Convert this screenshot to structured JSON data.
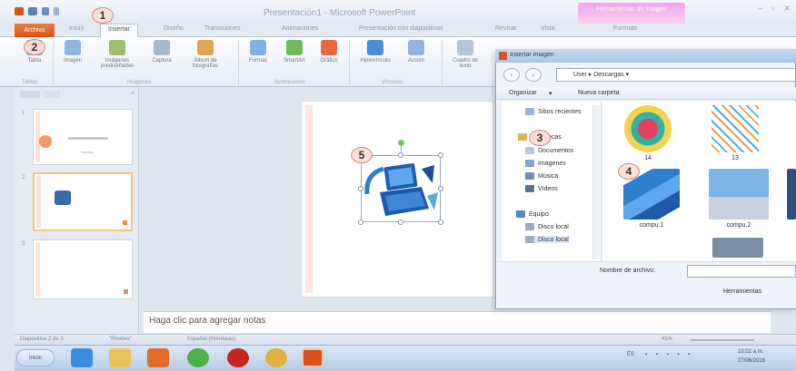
{
  "window": {
    "title": "Presentación1 - Microsoft PowerPoint",
    "context_tab_group": "Herramientas de imagen",
    "controls": [
      "–",
      "▫",
      "✕"
    ]
  },
  "tabs": {
    "file": "Archivo",
    "items": [
      {
        "label": "Inicio"
      },
      {
        "label": "Insertar",
        "active": true
      },
      {
        "label": "Diseño"
      },
      {
        "label": "Transiciones"
      },
      {
        "label": "Animaciones"
      },
      {
        "label": "Presentación con diapositivas"
      },
      {
        "label": "Revisar"
      },
      {
        "label": "Vista"
      },
      {
        "label": "Formato"
      }
    ]
  },
  "ribbon": {
    "buttons": [
      {
        "label": "Tabla",
        "icon": "table-icon",
        "color": "#7aa3d8"
      },
      {
        "label": "Imagen",
        "icon": "picture-icon",
        "color": "#8fb6e0"
      },
      {
        "label": "Imágenes prediseñadas",
        "icon": "clipart-icon",
        "color": "#9bc26b"
      },
      {
        "label": "Captura",
        "icon": "screenshot-icon",
        "color": "#a7b9cf"
      },
      {
        "label": "Álbum de fotografías",
        "icon": "photo-album-icon",
        "color": "#e2a455"
      },
      {
        "label": "Formas",
        "icon": "shapes-icon",
        "color": "#7cb2e8"
      },
      {
        "label": "SmartArt",
        "icon": "smartart-icon",
        "color": "#6dbb5a"
      },
      {
        "label": "Gráfico",
        "icon": "chart-icon",
        "color": "#e46a3a"
      },
      {
        "label": "Hipervínculo",
        "icon": "hyperlink-icon",
        "color": "#4a8fd6"
      },
      {
        "label": "Acción",
        "icon": "action-icon",
        "color": "#8fb6e0"
      },
      {
        "label": "Cuadro de texto",
        "icon": "textbox-icon",
        "color": "#b4c4d8"
      }
    ],
    "groups": [
      "Tablas",
      "Imágenes",
      "Ilustraciones",
      "Vínculos"
    ]
  },
  "slide_pane": {
    "thumbnails": [
      {
        "number": "1"
      },
      {
        "number": "2",
        "selected": true
      },
      {
        "number": "3"
      }
    ]
  },
  "notes": {
    "placeholder": "Haga clic para agregar notas"
  },
  "status_bar": {
    "slide_info": "Diapositiva 2 de 3",
    "theme": "\"Rhodes\"",
    "language": "Español (Honduras)",
    "zoom": "45%"
  },
  "taskbar": {
    "start": "Inicio",
    "apps": [
      {
        "icon": "internet-explorer-icon",
        "color": "#3b8de0"
      },
      {
        "icon": "folder-icon",
        "color": "#e8c35a"
      },
      {
        "icon": "media-player-icon",
        "color": "#e26b2b"
      },
      {
        "icon": "green-app-icon",
        "color": "#4fb14a"
      },
      {
        "icon": "red-app-icon",
        "color": "#c8251e"
      },
      {
        "icon": "chrome-icon",
        "color": "#e0b23c"
      },
      {
        "icon": "powerpoint-icon",
        "color": "#d9531b"
      }
    ],
    "lang": "ES",
    "time": "10:02 a.m.",
    "date": "27/06/2016"
  },
  "dialog": {
    "title": "Insertar imagen",
    "path": [
      "User",
      "Descargas"
    ],
    "organize": "Organizar",
    "new_folder": "Nueva carpeta",
    "nav_items": [
      {
        "label": "Sitios recientes",
        "icon": "recent-places-icon"
      },
      {
        "label": "Bibliotecas",
        "icon": "libraries-icon"
      },
      {
        "label": "Documentos",
        "icon": "documents-icon"
      },
      {
        "label": "Imágenes",
        "icon": "pictures-icon"
      },
      {
        "label": "Música",
        "icon": "music-icon"
      },
      {
        "label": "Vídeos",
        "icon": "videos-icon"
      },
      {
        "label": "Equipo",
        "icon": "computer-icon"
      },
      {
        "label": "Disco local",
        "icon": "local-disk-icon"
      },
      {
        "label": "Disco local",
        "icon": "local-disk-icon"
      }
    ],
    "files": [
      {
        "name": "14"
      },
      {
        "name": "13"
      },
      {
        "name": "compu.1"
      },
      {
        "name": "compu.2"
      }
    ],
    "filename_label": "Nombre de archivo:",
    "tools_label": "Herramientas"
  },
  "callouts": [
    "1",
    "2",
    "3",
    "4",
    "5"
  ]
}
